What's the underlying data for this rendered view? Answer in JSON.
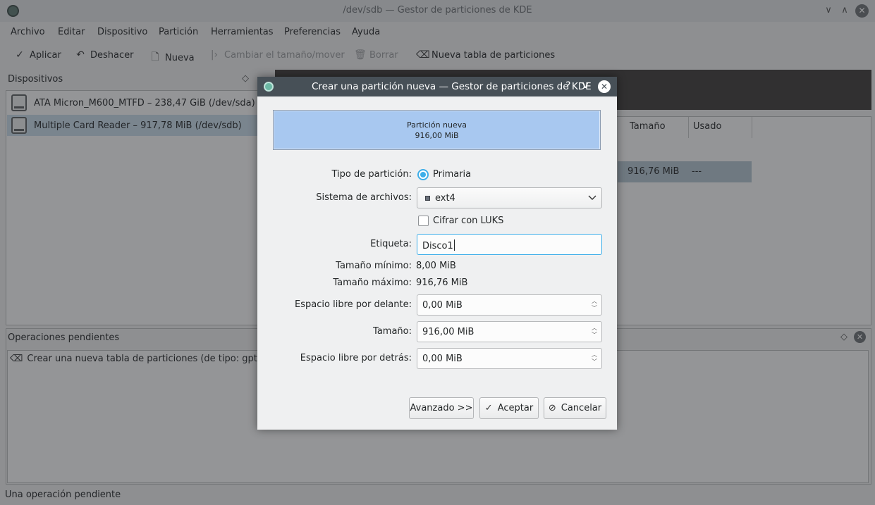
{
  "window": {
    "title": "/dev/sdb — Gestor de particiones de KDE"
  },
  "menu": [
    "Archivo",
    "Editar",
    "Dispositivo",
    "Partición",
    "Herramientas",
    "Preferencias",
    "Ayuda"
  ],
  "toolbar": {
    "apply": "Aplicar",
    "undo": "Deshacer",
    "new": "Nueva",
    "resize": "Cambiar el tamaño/mover",
    "delete": "Borrar",
    "new_table": "Nueva tabla de particiones"
  },
  "devices": {
    "title": "Dispositivos",
    "items": [
      "ATA Micron_M600_MTFD – 238,47 GiB (/dev/sda)",
      "Multiple Card Reader – 917,78 MiB (/dev/sdb)"
    ]
  },
  "partition_table": {
    "col_size": "Tamaño",
    "col_used": "Usado",
    "row_size": "916,76 MiB",
    "row_used": "---"
  },
  "pending": {
    "title": "Operaciones pendientes",
    "item": "Crear una nueva tabla de particiones (de tipo: gpt) en «"
  },
  "status_text": "Una operación pendiente",
  "dialog": {
    "title": "Crear una partición nueva — Gestor de particiones de KDE",
    "help_glyph": "?",
    "preview_name": "Partición nueva",
    "preview_size": "916,00 MiB",
    "type_label": "Tipo de partición:",
    "type_value": "Primaria",
    "fs_label": "Sistema de archivos:",
    "fs_value": "ext4",
    "encrypt_label": "Cifrar con LUKS",
    "label_label": "Etiqueta:",
    "label_value": "Disco1",
    "min_label": "Tamaño mínimo:",
    "min_value": "8,00 MiB",
    "max_label": "Tamaño máximo:",
    "max_value": "916,76 MiB",
    "free_before_label": "Espacio libre por delante:",
    "free_before_value": "0,00 MiB",
    "size_label": "Tamaño:",
    "size_value": "916,00 MiB",
    "free_after_label": "Espacio libre por detrás:",
    "free_after_value": "0,00 MiB",
    "advanced_button": "Avanzado >>",
    "accept_button": "Aceptar",
    "cancel_button": "Cancelar"
  }
}
